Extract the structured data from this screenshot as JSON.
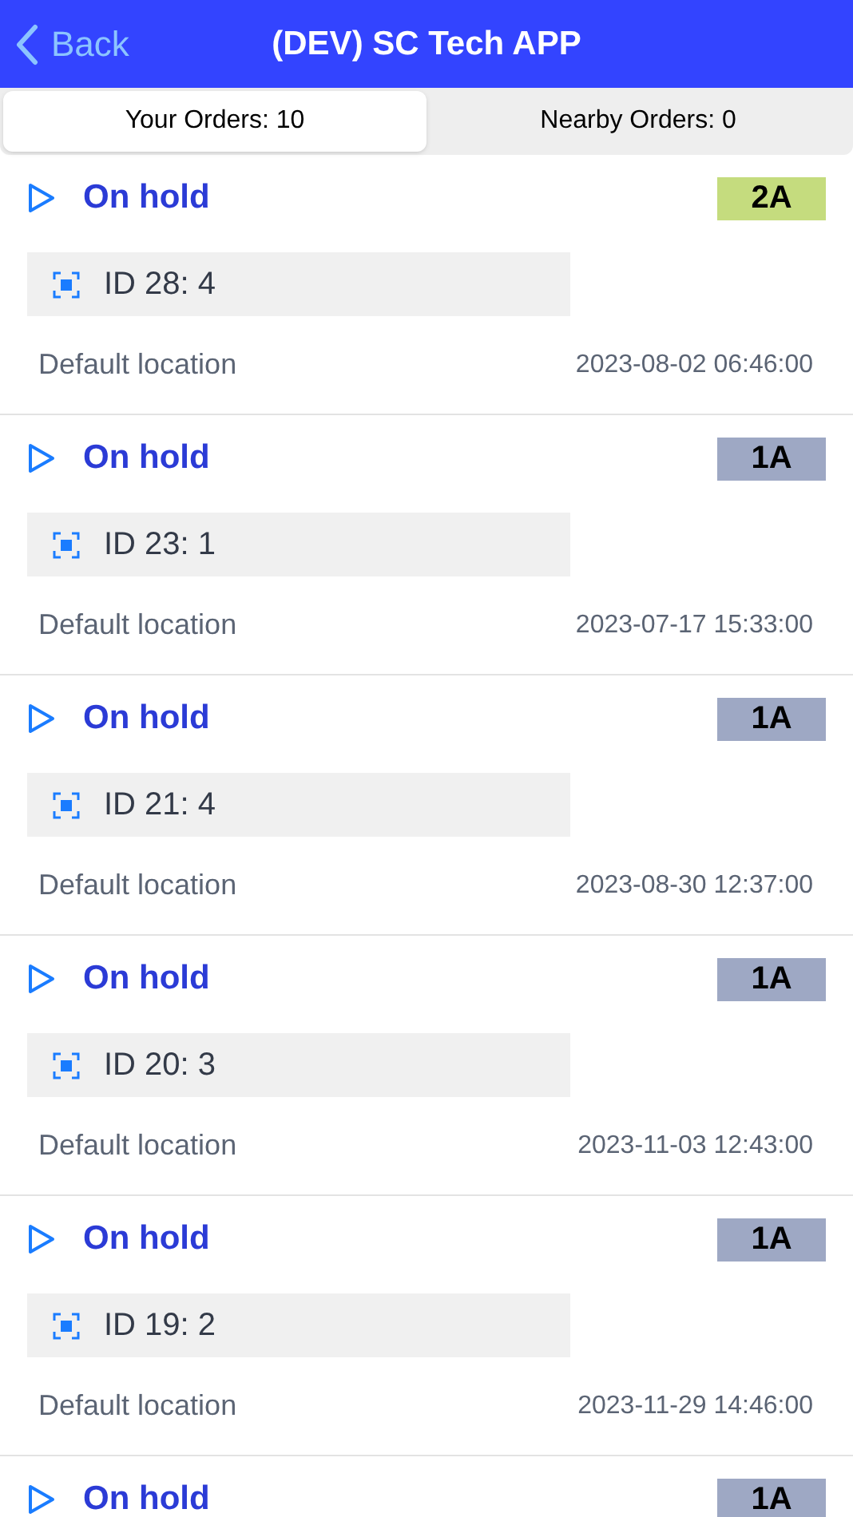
{
  "header": {
    "back": "Back",
    "title": "(DEV) SC Tech APP"
  },
  "tabs": [
    {
      "label": "Your Orders: 10",
      "selected": true
    },
    {
      "label": "Nearby Orders: 0",
      "selected": false
    }
  ],
  "orders": [
    {
      "status": "On hold",
      "badge": "2A",
      "color": "#c5dc7e",
      "id": "ID 28: 4",
      "location": "Default location",
      "time": "2023-08-02 06:46:00"
    },
    {
      "status": "On hold",
      "badge": "1A",
      "color": "#9ea8c4",
      "id": "ID 23: 1",
      "location": "Default location",
      "time": "2023-07-17 15:33:00"
    },
    {
      "status": "On hold",
      "badge": "1A",
      "color": "#9ea8c4",
      "id": "ID 21: 4",
      "location": "Default location",
      "time": "2023-08-30 12:37:00"
    },
    {
      "status": "On hold",
      "badge": "1A",
      "color": "#9ea8c4",
      "id": "ID 20: 3",
      "location": "Default location",
      "time": "2023-11-03 12:43:00"
    },
    {
      "status": "On hold",
      "badge": "1A",
      "color": "#9ea8c4",
      "id": "ID 19: 2",
      "location": "Default location",
      "time": "2023-11-29 14:46:00"
    },
    {
      "status": "On hold",
      "badge": "1A",
      "color": "#9ea8c4"
    }
  ]
}
